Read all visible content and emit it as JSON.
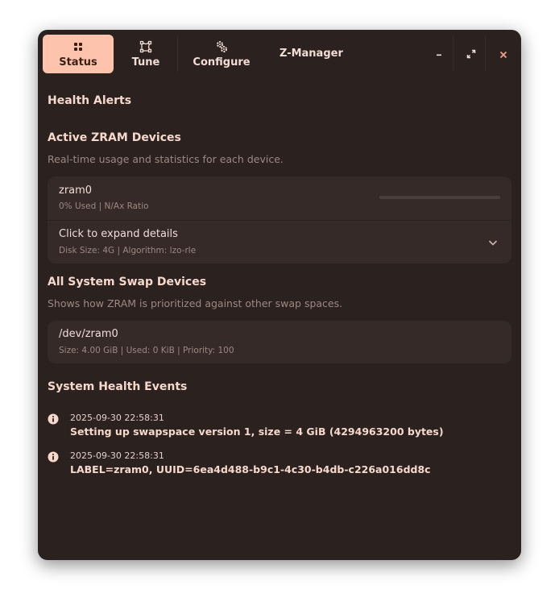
{
  "header": {
    "tabs": [
      {
        "label": "Status",
        "icon": "grid-icon",
        "active": true
      },
      {
        "label": "Tune",
        "icon": "vector-tune-icon",
        "active": false
      },
      {
        "label": "Configure",
        "icon": "gears-icon",
        "active": false
      }
    ],
    "title": "Z-Manager",
    "window_buttons": [
      "minimize-icon",
      "maximize-icon",
      "close-icon"
    ]
  },
  "health_alerts": {
    "heading": "Health Alerts"
  },
  "zram": {
    "heading": "Active ZRAM Devices",
    "subtitle": "Real-time usage and statistics for each device.",
    "device": {
      "name": "zram0",
      "summary": "0% Used | N/Ax Ratio",
      "usage_fraction": 0.0,
      "expander_title": "Click to expand details",
      "expander_sub": "Disk Size: 4G | Algorithm: lzo-rle"
    }
  },
  "swap": {
    "heading": "All System Swap Devices",
    "subtitle": "Shows how ZRAM is prioritized against other swap spaces.",
    "devices": [
      {
        "name": "/dev/zram0",
        "details": "Size: 4.00 GiB | Used: 0 KiB | Priority: 100"
      }
    ]
  },
  "events": {
    "heading": "System Health Events",
    "items": [
      {
        "icon": "info-icon",
        "timestamp": "2025-09-30 22:58:31",
        "message": "Setting up swapspace version 1, size = 4 GiB (4294963200 bytes)"
      },
      {
        "icon": "info-icon",
        "timestamp": "2025-09-30 22:58:31",
        "message": "LABEL=zram0, UUID=6ea4d488-b9c1-4c30-b4db-c226a016dd8c"
      }
    ]
  },
  "colors": {
    "window_bg": "#2b211f",
    "card_bg": "#352a28",
    "accent": "#fdc3ad",
    "close": "#f2a08e"
  }
}
